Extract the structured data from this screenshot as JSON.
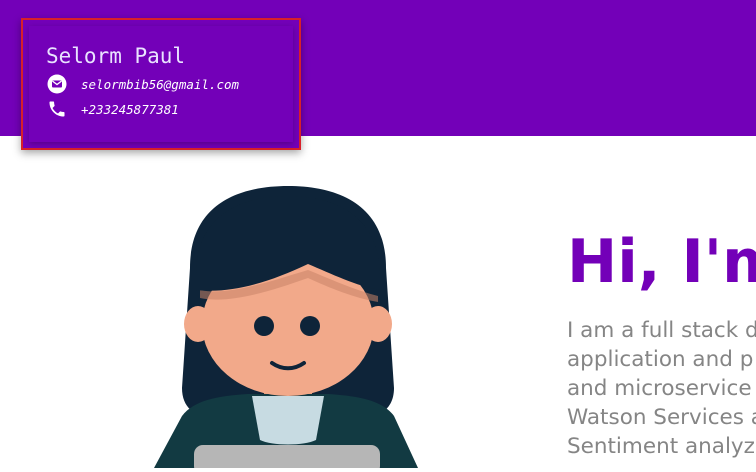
{
  "contact": {
    "name": "Selorm Paul",
    "email": "selormbib56@gmail.com",
    "phone": "+233245877381",
    "icons": [
      "envelope-icon",
      "phone-icon"
    ]
  },
  "hero": {
    "title": "Hi, I'm",
    "description_lines": [
      "I am a full stack d",
      "application and p",
      "and microservice",
      "Watson Services a",
      "Sentiment analyz"
    ]
  },
  "colors": {
    "brand_purple": "#7300b8",
    "card_border": "#d8202a",
    "body_text": "#858585"
  }
}
